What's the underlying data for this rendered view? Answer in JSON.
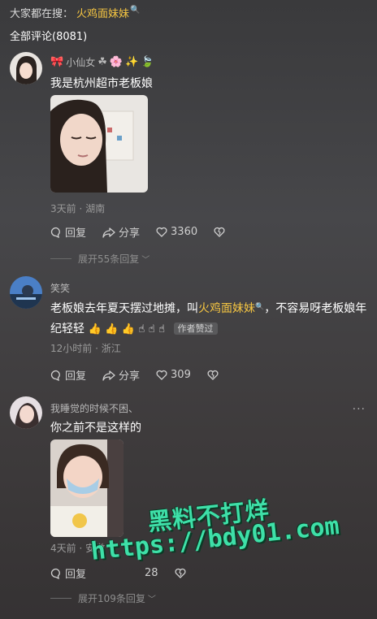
{
  "search": {
    "prefix": "大家都在搜：",
    "term": "火鸡面妹妹"
  },
  "comments_count": "全部评论(8081)",
  "comments": [
    {
      "username": "小仙女",
      "text": "我是杭州超市老板娘",
      "meta": "3天前 · 湖南",
      "reply": "回复",
      "share": "分享",
      "likes": "3360",
      "expand": "展开55条回复"
    },
    {
      "username": "笑笑",
      "text_before": "老板娘去年夏天摆过地摊，叫",
      "text_link": "火鸡面妹妹",
      "text_after": "，不容易呀老板娘年纪轻轻",
      "author_tag": "作者赞过",
      "meta": "12小时前 · 浙江",
      "reply": "回复",
      "share": "分享",
      "likes": "309"
    },
    {
      "username": "我睡觉的时候不困、",
      "text": "你之前不是这样的",
      "meta": "4天前 · 安徽",
      "reply": "回复",
      "likes": "28",
      "expand": "展开109条回复"
    }
  ],
  "watermark": {
    "line1": "黑料不打烊",
    "line2": "https://bdy01.com"
  },
  "colors": {
    "accent": "#f5c542",
    "watermark": "#3ee0a8"
  }
}
